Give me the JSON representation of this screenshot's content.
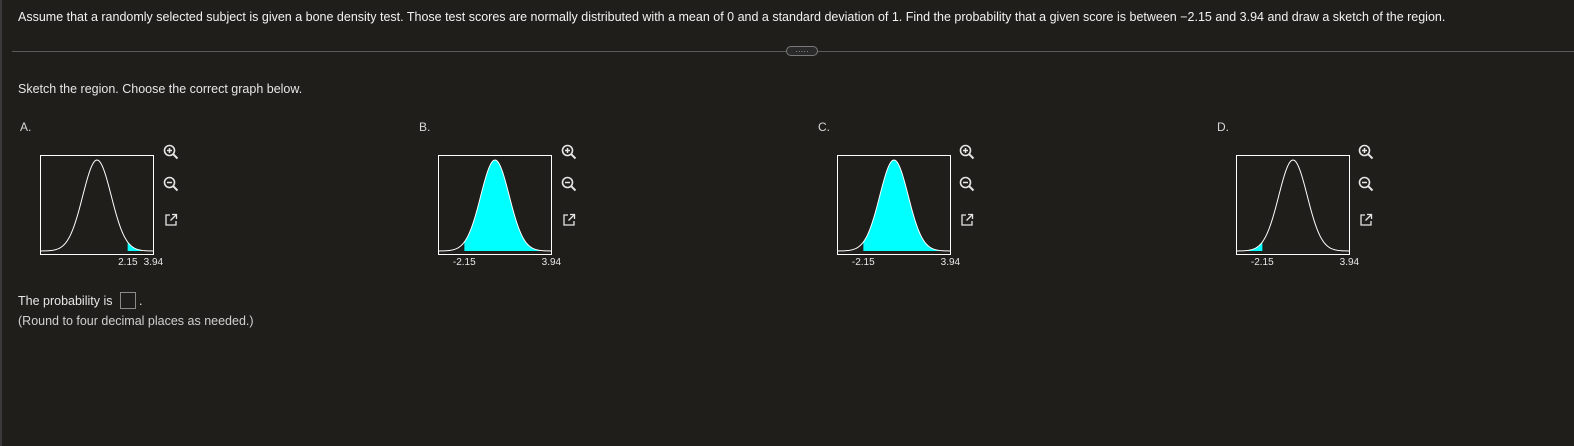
{
  "question": {
    "text": "Assume that a randomly selected subject is given a bone density test. Those test scores are normally distributed with a mean of 0 and a standard deviation of 1. Find the probability that a given score is between  −2.15 and 3.94 and draw a sketch of the region."
  },
  "more_button": {
    "label": "·····"
  },
  "instruction": "Sketch the region. Choose the correct graph below.",
  "colors": {
    "fill": "#00ffff",
    "curve": "#ffffff",
    "frame": "#ffffff",
    "background": "#1f1e1b"
  },
  "options": [
    {
      "letter": "A.",
      "lower": 2.15,
      "upper": 3.94,
      "shade": "tail-right",
      "tick_low": "2.15",
      "tick_high": "3.94"
    },
    {
      "letter": "B.",
      "lower": -2.15,
      "upper": 3.94,
      "shade": "between",
      "tick_low": "-2.15",
      "tick_high": "3.94"
    },
    {
      "letter": "C.",
      "lower": -2.15,
      "upper": 3.94,
      "shade": "between",
      "tick_low": "-2.15",
      "tick_high": "3.94"
    },
    {
      "letter": "D.",
      "lower": -2.15,
      "upper": 3.94,
      "shade": "tail-left",
      "tick_low": "-2.15",
      "tick_high": "3.94"
    }
  ],
  "tools": {
    "zoom_in": "zoom-in-icon",
    "zoom_out": "zoom-out-icon",
    "open": "open-new-window-icon"
  },
  "answer": {
    "label": "The probability is",
    "value": "",
    "period": ".",
    "hint": "(Round to four decimal places as needed.)"
  }
}
